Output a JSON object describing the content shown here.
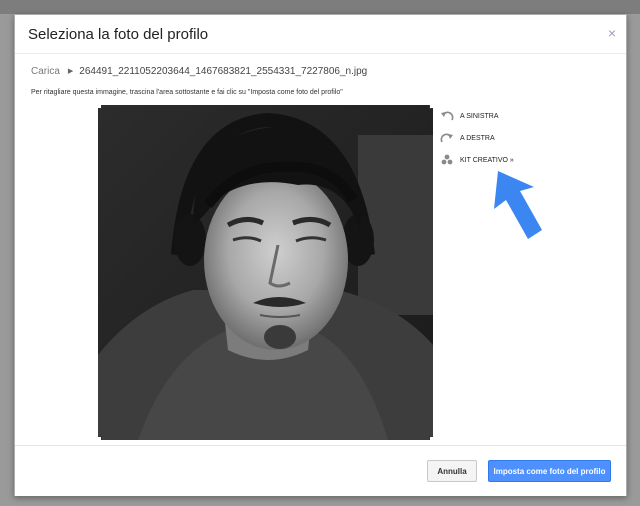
{
  "dialog": {
    "title": "Seleziona la foto del profilo",
    "close_glyph": "×"
  },
  "breadcrumb": {
    "root": "Carica",
    "separator": "▶",
    "file": "264491_2211052203644_1467683821_2554331_7227806_n.jpg"
  },
  "instructions": "Per ritagliare questa immagine, trascina l'area sottostante e fai clic su \"Imposta come foto del profilo\"",
  "tools": {
    "rotate_left": "A SINISTRA",
    "rotate_right": "A DESTRA",
    "creative_kit": "KIT CREATIVO »"
  },
  "footer": {
    "cancel_label": "Annulla",
    "primary_label": "Imposta come foto del profilo"
  },
  "colors": {
    "primary_button": "#4d90fe",
    "arrow": "#3b86f0",
    "close": "#9aa0c8"
  },
  "icons": {
    "rotate_left": "rotate-left-icon",
    "rotate_right": "rotate-right-icon",
    "creative_kit": "creative-kit-icon",
    "annotation": "blue-arrow-icon"
  }
}
